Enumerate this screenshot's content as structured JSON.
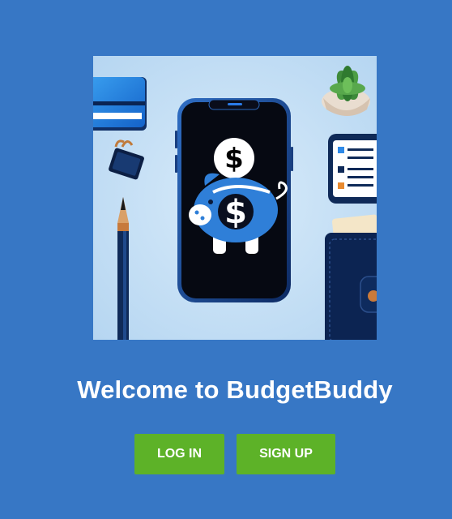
{
  "welcome": {
    "title": "Welcome to BudgetBuddy"
  },
  "actions": {
    "login_label": "LOG IN",
    "signup_label": "SIGN UP"
  },
  "hero_image": {
    "icons": [
      "credit-card-icon",
      "smartphone-icon",
      "piggy-bank-icon",
      "dollar-coin-icon",
      "pencil-icon",
      "binder-clip-icon",
      "succulent-plant-icon",
      "checklist-tablet-icon",
      "wallet-icon"
    ]
  },
  "colors": {
    "background": "#3777c5",
    "button": "#5db228",
    "text": "#ffffff"
  }
}
